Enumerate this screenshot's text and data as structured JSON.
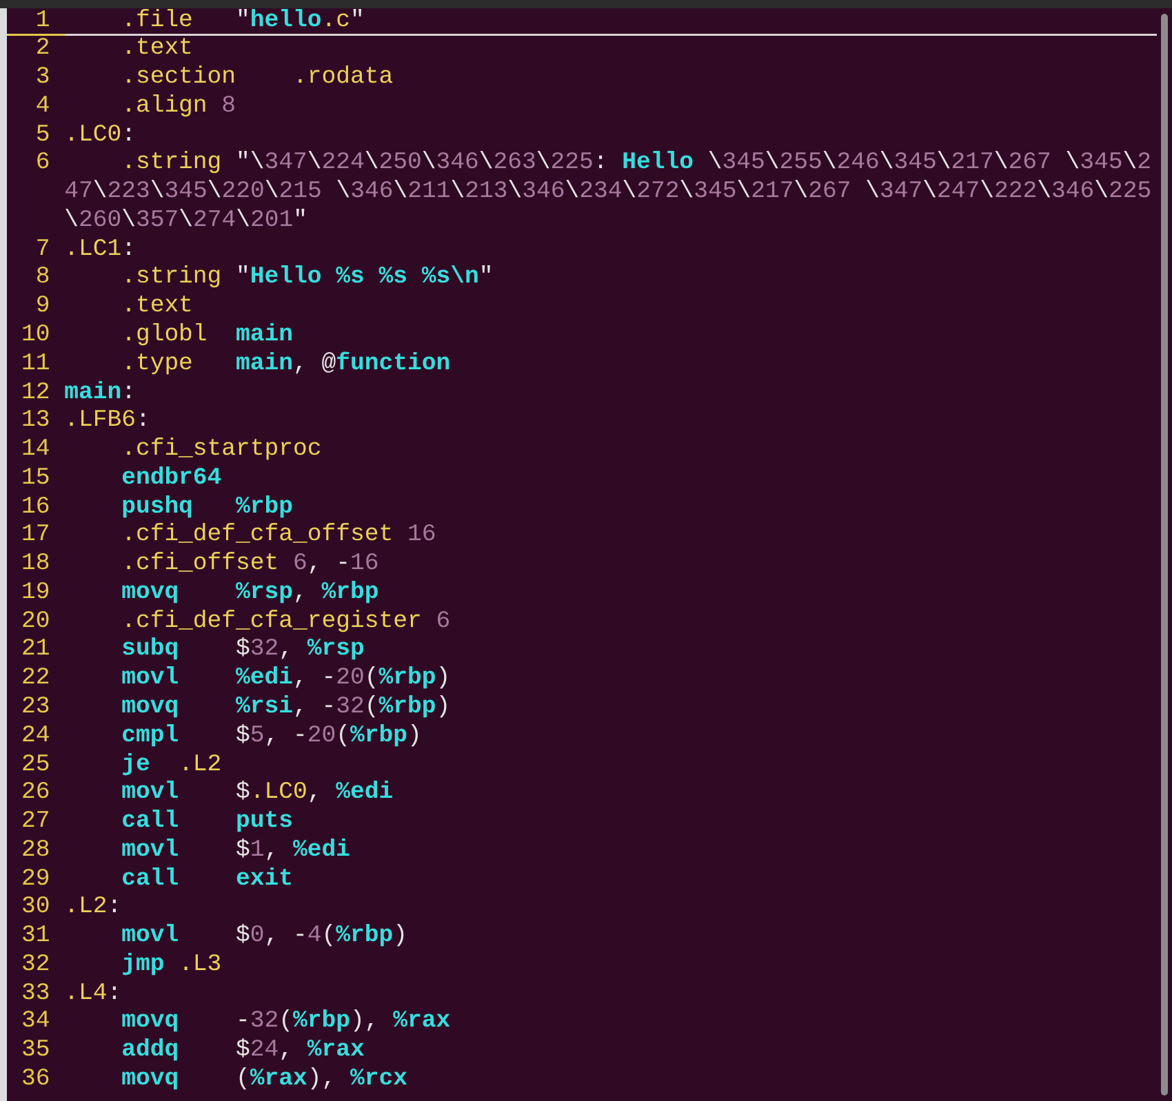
{
  "editor": {
    "lines": [
      {
        "number": "1",
        "current": true,
        "indented": true,
        "tokens": [
          {
            "kind": "dir",
            "text": ".file"
          },
          {
            "kind": "txt",
            "text": "   \""
          },
          {
            "kind": "kw",
            "text": "hello"
          },
          {
            "kind": "dir",
            "text": ".c"
          },
          {
            "kind": "txt",
            "text": "\""
          }
        ]
      },
      {
        "number": "2",
        "current": false,
        "indented": true,
        "tokens": [
          {
            "kind": "dir",
            "text": ".text"
          }
        ]
      },
      {
        "number": "3",
        "current": false,
        "indented": true,
        "tokens": [
          {
            "kind": "dir",
            "text": ".section    "
          },
          {
            "kind": "dir",
            "text": ".rodata"
          }
        ]
      },
      {
        "number": "4",
        "current": false,
        "indented": true,
        "tokens": [
          {
            "kind": "dir",
            "text": ".align "
          },
          {
            "kind": "num",
            "text": "8"
          }
        ]
      },
      {
        "number": "5",
        "current": false,
        "indented": false,
        "tokens": [
          {
            "kind": "dir",
            "text": ".LC0"
          },
          {
            "kind": "txt",
            "text": ":"
          }
        ]
      },
      {
        "number": "6",
        "current": false,
        "indented": true,
        "tokens": [
          {
            "kind": "dir",
            "text": ".string"
          },
          {
            "kind": "txt",
            "text": " \"\\"
          },
          {
            "kind": "num",
            "text": "347"
          },
          {
            "kind": "txt",
            "text": "\\"
          },
          {
            "kind": "num",
            "text": "224"
          },
          {
            "kind": "txt",
            "text": "\\"
          },
          {
            "kind": "num",
            "text": "250"
          },
          {
            "kind": "txt",
            "text": "\\"
          },
          {
            "kind": "num",
            "text": "346"
          },
          {
            "kind": "txt",
            "text": "\\"
          },
          {
            "kind": "num",
            "text": "263"
          },
          {
            "kind": "txt",
            "text": "\\"
          },
          {
            "kind": "num",
            "text": "225"
          },
          {
            "kind": "txt",
            "text": ": "
          },
          {
            "kind": "kw",
            "text": "Hello"
          },
          {
            "kind": "txt",
            "text": " \\"
          },
          {
            "kind": "num",
            "text": "345"
          },
          {
            "kind": "txt",
            "text": "\\"
          },
          {
            "kind": "num",
            "text": "255"
          },
          {
            "kind": "txt",
            "text": "\\"
          },
          {
            "kind": "num",
            "text": "246"
          },
          {
            "kind": "txt",
            "text": "\\"
          },
          {
            "kind": "num",
            "text": "345"
          },
          {
            "kind": "txt",
            "text": "\\"
          },
          {
            "kind": "num",
            "text": "217"
          },
          {
            "kind": "txt",
            "text": "\\"
          },
          {
            "kind": "num",
            "text": "267"
          },
          {
            "kind": "txt",
            "text": " \\"
          },
          {
            "kind": "num",
            "text": "345"
          },
          {
            "kind": "txt",
            "text": "\\"
          },
          {
            "kind": "num",
            "text": "247"
          },
          {
            "kind": "txt",
            "text": "\\"
          },
          {
            "kind": "num",
            "text": "223"
          },
          {
            "kind": "txt",
            "text": "\\"
          },
          {
            "kind": "num",
            "text": "345"
          },
          {
            "kind": "txt",
            "text": "\\"
          },
          {
            "kind": "num",
            "text": "220"
          },
          {
            "kind": "txt",
            "text": "\\"
          },
          {
            "kind": "num",
            "text": "215"
          },
          {
            "kind": "txt",
            "text": " \\"
          },
          {
            "kind": "num",
            "text": "346"
          },
          {
            "kind": "txt",
            "text": "\\"
          },
          {
            "kind": "num",
            "text": "211"
          },
          {
            "kind": "txt",
            "text": "\\"
          },
          {
            "kind": "num",
            "text": "213"
          },
          {
            "kind": "txt",
            "text": "\\"
          },
          {
            "kind": "num",
            "text": "346"
          },
          {
            "kind": "txt",
            "text": "\\"
          },
          {
            "kind": "num",
            "text": "234"
          },
          {
            "kind": "txt",
            "text": "\\"
          },
          {
            "kind": "num",
            "text": "272"
          },
          {
            "kind": "txt",
            "text": "\\"
          },
          {
            "kind": "num",
            "text": "345"
          },
          {
            "kind": "txt",
            "text": "\\"
          },
          {
            "kind": "num",
            "text": "217"
          },
          {
            "kind": "txt",
            "text": "\\"
          },
          {
            "kind": "num",
            "text": "267"
          },
          {
            "kind": "txt",
            "text": " \\"
          },
          {
            "kind": "num",
            "text": "347"
          },
          {
            "kind": "txt",
            "text": "\\"
          },
          {
            "kind": "num",
            "text": "247"
          },
          {
            "kind": "txt",
            "text": "\\"
          },
          {
            "kind": "num",
            "text": "222"
          },
          {
            "kind": "txt",
            "text": "\\"
          },
          {
            "kind": "num",
            "text": "346"
          },
          {
            "kind": "txt",
            "text": "\\"
          },
          {
            "kind": "num",
            "text": "225"
          },
          {
            "kind": "txt",
            "text": "\\"
          },
          {
            "kind": "num",
            "text": "260"
          },
          {
            "kind": "txt",
            "text": "\\"
          },
          {
            "kind": "num",
            "text": "357"
          },
          {
            "kind": "txt",
            "text": "\\"
          },
          {
            "kind": "num",
            "text": "274"
          },
          {
            "kind": "txt",
            "text": "\\"
          },
          {
            "kind": "num",
            "text": "201"
          },
          {
            "kind": "txt",
            "text": "\""
          }
        ]
      },
      {
        "number": "7",
        "current": false,
        "indented": false,
        "tokens": [
          {
            "kind": "dir",
            "text": ".LC1"
          },
          {
            "kind": "txt",
            "text": ":"
          }
        ]
      },
      {
        "number": "8",
        "current": false,
        "indented": true,
        "tokens": [
          {
            "kind": "dir",
            "text": ".string"
          },
          {
            "kind": "txt",
            "text": " \""
          },
          {
            "kind": "kw",
            "text": "Hello %s %s %s\\n"
          },
          {
            "kind": "txt",
            "text": "\""
          }
        ]
      },
      {
        "number": "9",
        "current": false,
        "indented": true,
        "tokens": [
          {
            "kind": "dir",
            "text": ".text"
          }
        ]
      },
      {
        "number": "10",
        "current": false,
        "indented": true,
        "tokens": [
          {
            "kind": "dir",
            "text": ".globl  "
          },
          {
            "kind": "kw",
            "text": "main"
          }
        ]
      },
      {
        "number": "11",
        "current": false,
        "indented": true,
        "tokens": [
          {
            "kind": "dir",
            "text": ".type   "
          },
          {
            "kind": "kw",
            "text": "main"
          },
          {
            "kind": "txt",
            "text": ", @"
          },
          {
            "kind": "kw",
            "text": "function"
          }
        ]
      },
      {
        "number": "12",
        "current": false,
        "indented": false,
        "tokens": [
          {
            "kind": "kw",
            "text": "main"
          },
          {
            "kind": "txt",
            "text": ":"
          }
        ]
      },
      {
        "number": "13",
        "current": false,
        "indented": false,
        "tokens": [
          {
            "kind": "dir",
            "text": ".LFB6"
          },
          {
            "kind": "txt",
            "text": ":"
          }
        ]
      },
      {
        "number": "14",
        "current": false,
        "indented": true,
        "tokens": [
          {
            "kind": "dir",
            "text": ".cfi_startproc"
          }
        ]
      },
      {
        "number": "15",
        "current": false,
        "indented": true,
        "tokens": [
          {
            "kind": "kw",
            "text": "endbr64"
          }
        ]
      },
      {
        "number": "16",
        "current": false,
        "indented": true,
        "tokens": [
          {
            "kind": "kw",
            "text": "pushq   "
          },
          {
            "kind": "kw",
            "text": "%rbp"
          }
        ]
      },
      {
        "number": "17",
        "current": false,
        "indented": true,
        "tokens": [
          {
            "kind": "dir",
            "text": ".cfi_def_cfa_offset "
          },
          {
            "kind": "num",
            "text": "16"
          }
        ]
      },
      {
        "number": "18",
        "current": false,
        "indented": true,
        "tokens": [
          {
            "kind": "dir",
            "text": ".cfi_offset "
          },
          {
            "kind": "num",
            "text": "6"
          },
          {
            "kind": "txt",
            "text": ", -"
          },
          {
            "kind": "num",
            "text": "16"
          }
        ]
      },
      {
        "number": "19",
        "current": false,
        "indented": true,
        "tokens": [
          {
            "kind": "kw",
            "text": "movq    "
          },
          {
            "kind": "kw",
            "text": "%rsp"
          },
          {
            "kind": "txt",
            "text": ", "
          },
          {
            "kind": "kw",
            "text": "%rbp"
          }
        ]
      },
      {
        "number": "20",
        "current": false,
        "indented": true,
        "tokens": [
          {
            "kind": "dir",
            "text": ".cfi_def_cfa_register "
          },
          {
            "kind": "num",
            "text": "6"
          }
        ]
      },
      {
        "number": "21",
        "current": false,
        "indented": true,
        "tokens": [
          {
            "kind": "kw",
            "text": "subq"
          },
          {
            "kind": "txt",
            "text": "    $"
          },
          {
            "kind": "num",
            "text": "32"
          },
          {
            "kind": "txt",
            "text": ", "
          },
          {
            "kind": "kw",
            "text": "%rsp"
          }
        ]
      },
      {
        "number": "22",
        "current": false,
        "indented": true,
        "tokens": [
          {
            "kind": "kw",
            "text": "movl    "
          },
          {
            "kind": "kw",
            "text": "%edi"
          },
          {
            "kind": "txt",
            "text": ", -"
          },
          {
            "kind": "num",
            "text": "20"
          },
          {
            "kind": "txt",
            "text": "("
          },
          {
            "kind": "kw",
            "text": "%rbp"
          },
          {
            "kind": "txt",
            "text": ")"
          }
        ]
      },
      {
        "number": "23",
        "current": false,
        "indented": true,
        "tokens": [
          {
            "kind": "kw",
            "text": "movq    "
          },
          {
            "kind": "kw",
            "text": "%rsi"
          },
          {
            "kind": "txt",
            "text": ", -"
          },
          {
            "kind": "num",
            "text": "32"
          },
          {
            "kind": "txt",
            "text": "("
          },
          {
            "kind": "kw",
            "text": "%rbp"
          },
          {
            "kind": "txt",
            "text": ")"
          }
        ]
      },
      {
        "number": "24",
        "current": false,
        "indented": true,
        "tokens": [
          {
            "kind": "kw",
            "text": "cmpl"
          },
          {
            "kind": "txt",
            "text": "    $"
          },
          {
            "kind": "num",
            "text": "5"
          },
          {
            "kind": "txt",
            "text": ", -"
          },
          {
            "kind": "num",
            "text": "20"
          },
          {
            "kind": "txt",
            "text": "("
          },
          {
            "kind": "kw",
            "text": "%rbp"
          },
          {
            "kind": "txt",
            "text": ")"
          }
        ]
      },
      {
        "number": "25",
        "current": false,
        "indented": true,
        "tokens": [
          {
            "kind": "kw",
            "text": "je  "
          },
          {
            "kind": "dir",
            "text": ".L2"
          }
        ]
      },
      {
        "number": "26",
        "current": false,
        "indented": true,
        "tokens": [
          {
            "kind": "kw",
            "text": "movl"
          },
          {
            "kind": "txt",
            "text": "    $"
          },
          {
            "kind": "dir",
            "text": ".LC0"
          },
          {
            "kind": "txt",
            "text": ", "
          },
          {
            "kind": "kw",
            "text": "%edi"
          }
        ]
      },
      {
        "number": "27",
        "current": false,
        "indented": true,
        "tokens": [
          {
            "kind": "kw",
            "text": "call    "
          },
          {
            "kind": "kw",
            "text": "puts"
          }
        ]
      },
      {
        "number": "28",
        "current": false,
        "indented": true,
        "tokens": [
          {
            "kind": "kw",
            "text": "movl"
          },
          {
            "kind": "txt",
            "text": "    $"
          },
          {
            "kind": "num",
            "text": "1"
          },
          {
            "kind": "txt",
            "text": ", "
          },
          {
            "kind": "kw",
            "text": "%edi"
          }
        ]
      },
      {
        "number": "29",
        "current": false,
        "indented": true,
        "tokens": [
          {
            "kind": "kw",
            "text": "call    "
          },
          {
            "kind": "kw",
            "text": "exit"
          }
        ]
      },
      {
        "number": "30",
        "current": false,
        "indented": false,
        "tokens": [
          {
            "kind": "dir",
            "text": ".L2"
          },
          {
            "kind": "txt",
            "text": ":"
          }
        ]
      },
      {
        "number": "31",
        "current": false,
        "indented": true,
        "tokens": [
          {
            "kind": "kw",
            "text": "movl"
          },
          {
            "kind": "txt",
            "text": "    $"
          },
          {
            "kind": "num",
            "text": "0"
          },
          {
            "kind": "txt",
            "text": ", -"
          },
          {
            "kind": "num",
            "text": "4"
          },
          {
            "kind": "txt",
            "text": "("
          },
          {
            "kind": "kw",
            "text": "%rbp"
          },
          {
            "kind": "txt",
            "text": ")"
          }
        ]
      },
      {
        "number": "32",
        "current": false,
        "indented": true,
        "tokens": [
          {
            "kind": "kw",
            "text": "jmp "
          },
          {
            "kind": "dir",
            "text": ".L3"
          }
        ]
      },
      {
        "number": "33",
        "current": false,
        "indented": false,
        "tokens": [
          {
            "kind": "dir",
            "text": ".L4"
          },
          {
            "kind": "txt",
            "text": ":"
          }
        ]
      },
      {
        "number": "34",
        "current": false,
        "indented": true,
        "tokens": [
          {
            "kind": "kw",
            "text": "movq"
          },
          {
            "kind": "txt",
            "text": "    -"
          },
          {
            "kind": "num",
            "text": "32"
          },
          {
            "kind": "txt",
            "text": "("
          },
          {
            "kind": "kw",
            "text": "%rbp"
          },
          {
            "kind": "txt",
            "text": "), "
          },
          {
            "kind": "kw",
            "text": "%rax"
          }
        ]
      },
      {
        "number": "35",
        "current": false,
        "indented": true,
        "tokens": [
          {
            "kind": "kw",
            "text": "addq"
          },
          {
            "kind": "txt",
            "text": "    $"
          },
          {
            "kind": "num",
            "text": "24"
          },
          {
            "kind": "txt",
            "text": ", "
          },
          {
            "kind": "kw",
            "text": "%rax"
          }
        ]
      },
      {
        "number": "36",
        "current": false,
        "indented": true,
        "tokens": [
          {
            "kind": "kw",
            "text": "movq"
          },
          {
            "kind": "txt",
            "text": "    ("
          },
          {
            "kind": "kw",
            "text": "%rax"
          },
          {
            "kind": "txt",
            "text": "), "
          },
          {
            "kind": "kw",
            "text": "%rcx"
          }
        ]
      }
    ]
  }
}
